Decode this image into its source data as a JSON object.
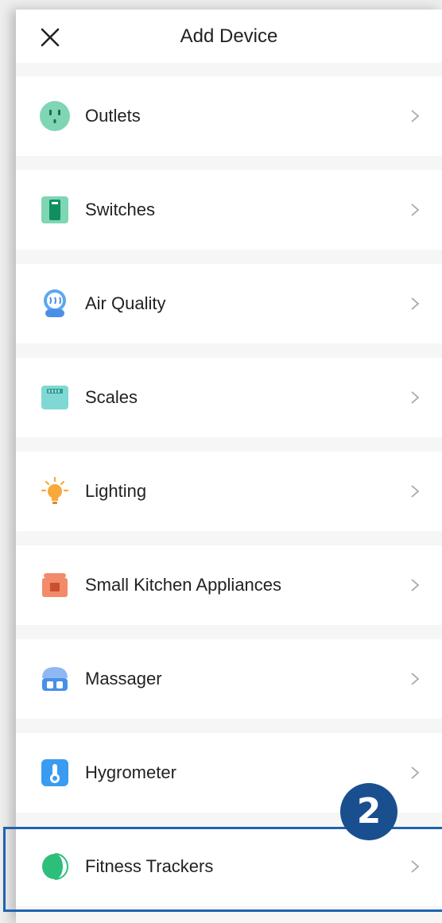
{
  "header": {
    "title": "Add Device",
    "close_icon": "close-icon"
  },
  "categories": [
    {
      "label": "Outlets",
      "icon": "outlet-icon",
      "color": "#7ed6b4"
    },
    {
      "label": "Switches",
      "icon": "switch-icon",
      "color": "#7ed6b4"
    },
    {
      "label": "Air Quality",
      "icon": "air-purifier-icon",
      "color": "#5aa9f0"
    },
    {
      "label": "Scales",
      "icon": "scale-icon",
      "color": "#7fd8d3"
    },
    {
      "label": "Lighting",
      "icon": "bulb-icon",
      "color": "#f7a93b"
    },
    {
      "label": "Small Kitchen Appliances",
      "icon": "pressure-cooker-icon",
      "color": "#f38b6a"
    },
    {
      "label": "Massager",
      "icon": "massager-icon",
      "color": "#4a8fe7"
    },
    {
      "label": "Hygrometer",
      "icon": "hygrometer-icon",
      "color": "#3a9cf0"
    },
    {
      "label": "Fitness Trackers",
      "icon": "fitness-tracker-icon",
      "color": "#2dbf7a"
    }
  ],
  "annotation": {
    "step_number": "2",
    "highlighted_item": "Fitness Trackers",
    "color": "#1f63b0"
  }
}
